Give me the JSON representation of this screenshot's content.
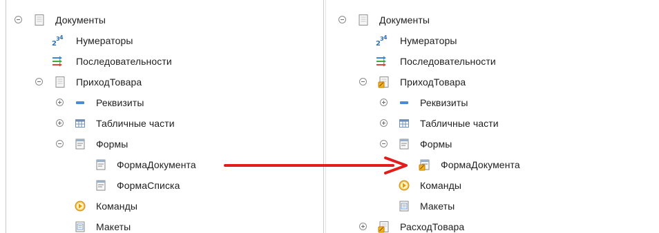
{
  "left_tree": {
    "documents": "Документы",
    "numerators": "Нумераторы",
    "sequences": "Последовательности",
    "prihod": "ПриходТовара",
    "requisites": "Реквизиты",
    "tabular": "Табличные части",
    "forms": "Формы",
    "forma_doc": "ФормаДокумента",
    "forma_list": "ФормаСписка",
    "commands": "Команды",
    "layouts": "Макеты"
  },
  "right_tree": {
    "documents": "Документы",
    "numerators": "Нумераторы",
    "sequences": "Последовательности",
    "prihod": "ПриходТовара",
    "requisites": "Реквизиты",
    "tabular": "Табличные части",
    "forms": "Формы",
    "forma_doc": "ФормаДокумента",
    "commands": "Команды",
    "layouts": "Макеты",
    "rashod": "РасходТовара"
  },
  "arrow_color": "#e11d1d"
}
